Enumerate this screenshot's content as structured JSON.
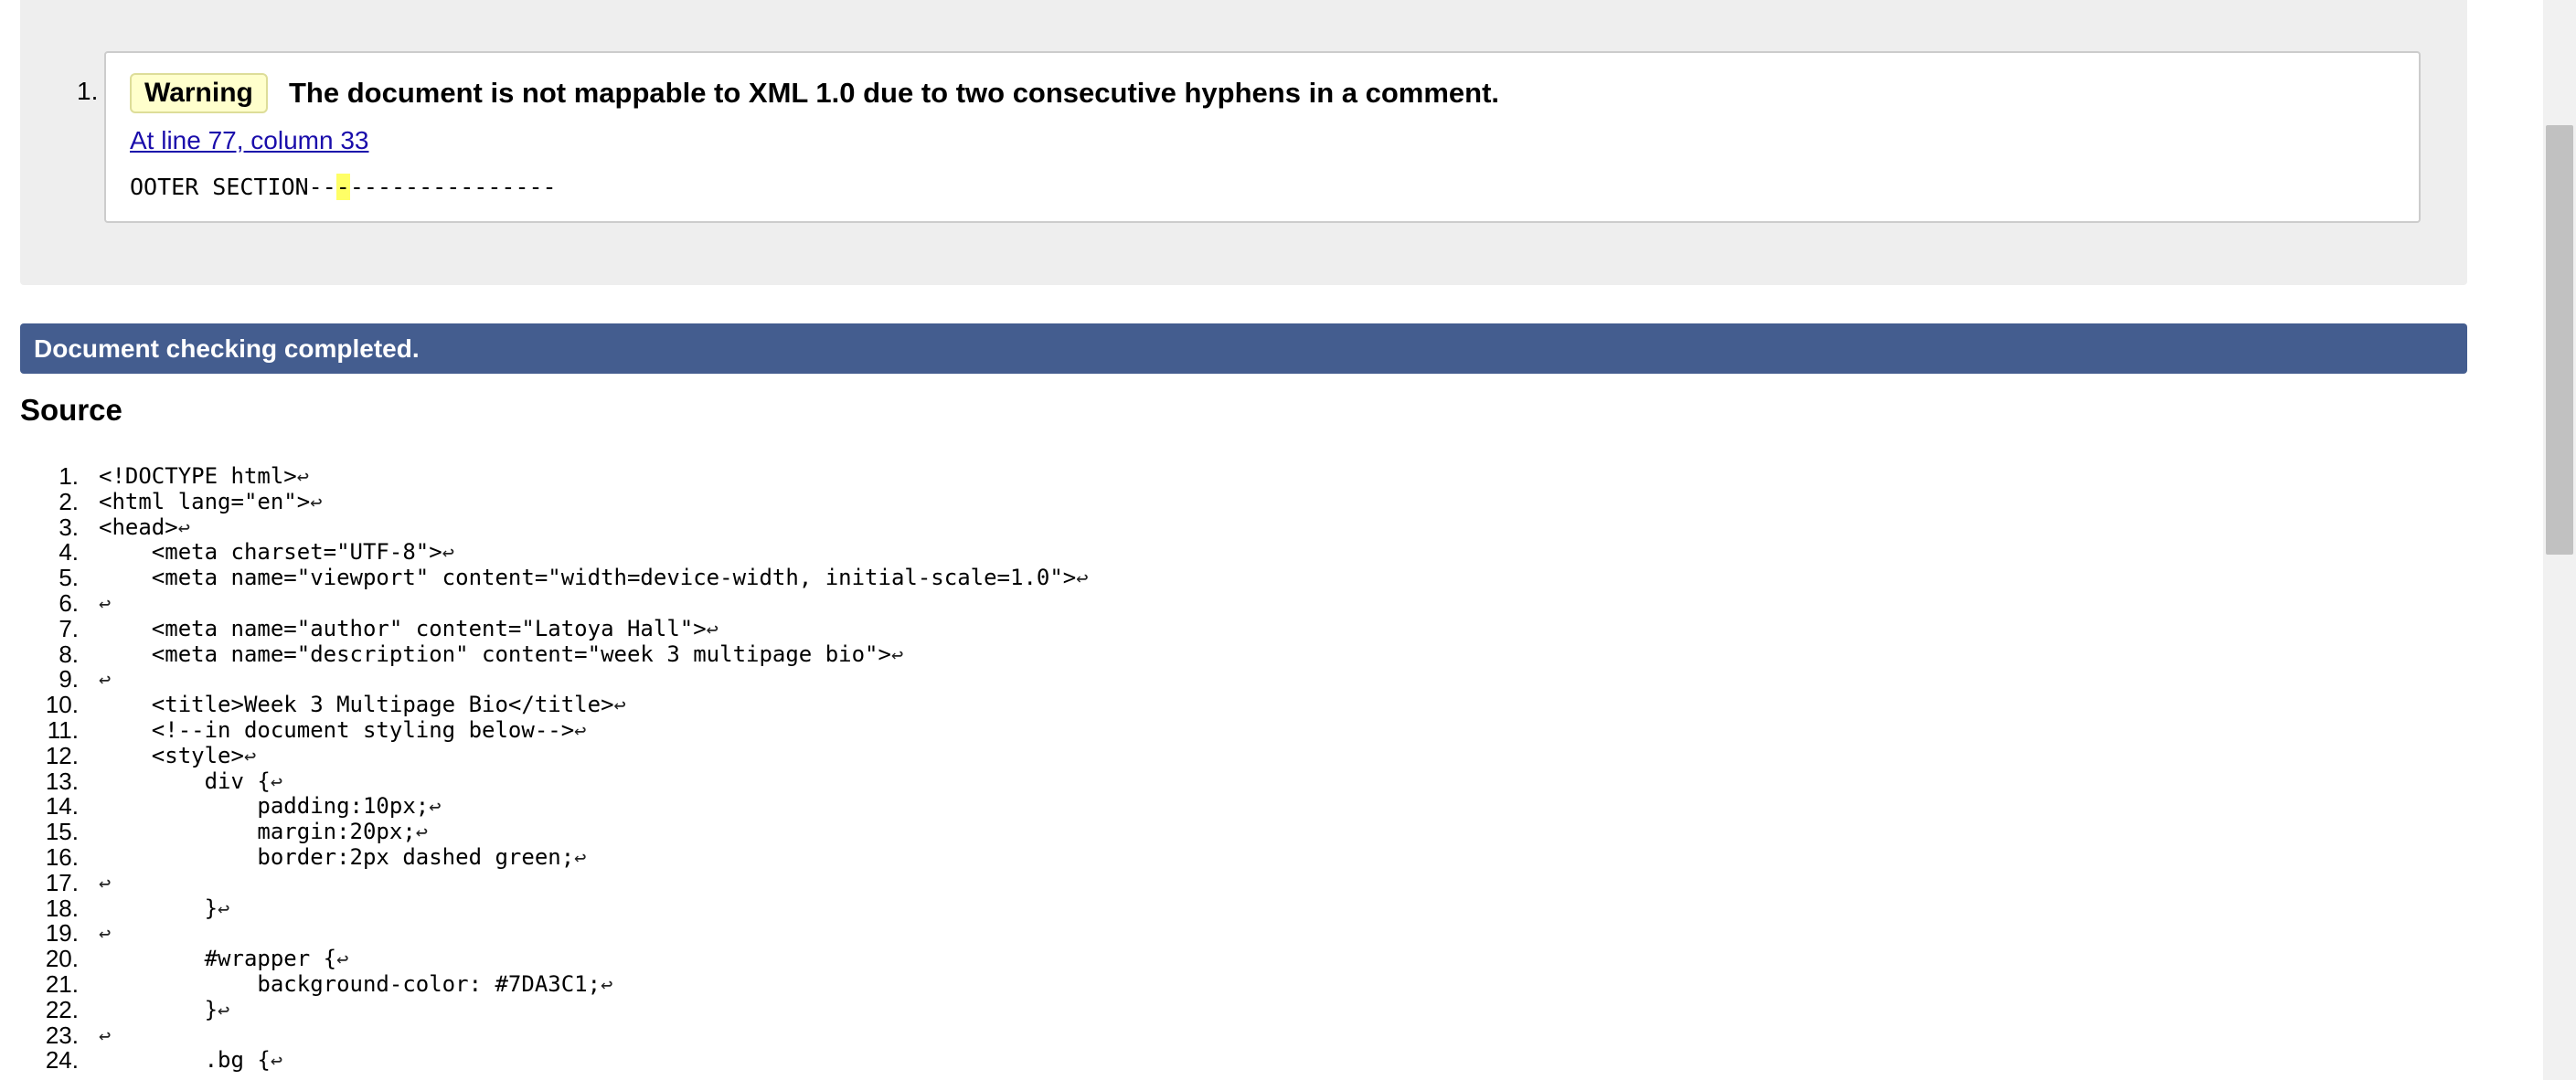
{
  "messages": [
    {
      "number": "1.",
      "badge": "Warning",
      "title": "The document is not mappable to XML 1.0 due to two consecutive hyphens in a comment.",
      "location": "At line 77, column 33",
      "extract_before": "OOTER SECTION--",
      "extract_highlight": "-",
      "extract_after": "---------------"
    }
  ],
  "status_bar": "Document checking completed.",
  "source_heading": "Source",
  "line_end_symbol": "↩",
  "source_lines": [
    {
      "n": "1.",
      "code": "<!DOCTYPE html>"
    },
    {
      "n": "2.",
      "code": "<html lang=\"en\">"
    },
    {
      "n": "3.",
      "code": "<head>"
    },
    {
      "n": "4.",
      "code": "    <meta charset=\"UTF-8\">"
    },
    {
      "n": "5.",
      "code": "    <meta name=\"viewport\" content=\"width=device-width, initial-scale=1.0\">"
    },
    {
      "n": "6.",
      "code": ""
    },
    {
      "n": "7.",
      "code": "    <meta name=\"author\" content=\"Latoya Hall\">"
    },
    {
      "n": "8.",
      "code": "    <meta name=\"description\" content=\"week 3 multipage bio\">"
    },
    {
      "n": "9.",
      "code": ""
    },
    {
      "n": "10.",
      "code": "    <title>Week 3 Multipage Bio</title>"
    },
    {
      "n": "11.",
      "code": "    <!--in document styling below-->"
    },
    {
      "n": "12.",
      "code": "    <style>"
    },
    {
      "n": "13.",
      "code": "        div {"
    },
    {
      "n": "14.",
      "code": "            padding:10px;"
    },
    {
      "n": "15.",
      "code": "            margin:20px;"
    },
    {
      "n": "16.",
      "code": "            border:2px dashed green;"
    },
    {
      "n": "17.",
      "code": ""
    },
    {
      "n": "18.",
      "code": "        }"
    },
    {
      "n": "19.",
      "code": ""
    },
    {
      "n": "20.",
      "code": "        #wrapper {"
    },
    {
      "n": "21.",
      "code": "            background-color: #7DA3C1;"
    },
    {
      "n": "22.",
      "code": "        }"
    },
    {
      "n": "23.",
      "code": ""
    },
    {
      "n": "24.",
      "code": "        .bg {"
    }
  ]
}
